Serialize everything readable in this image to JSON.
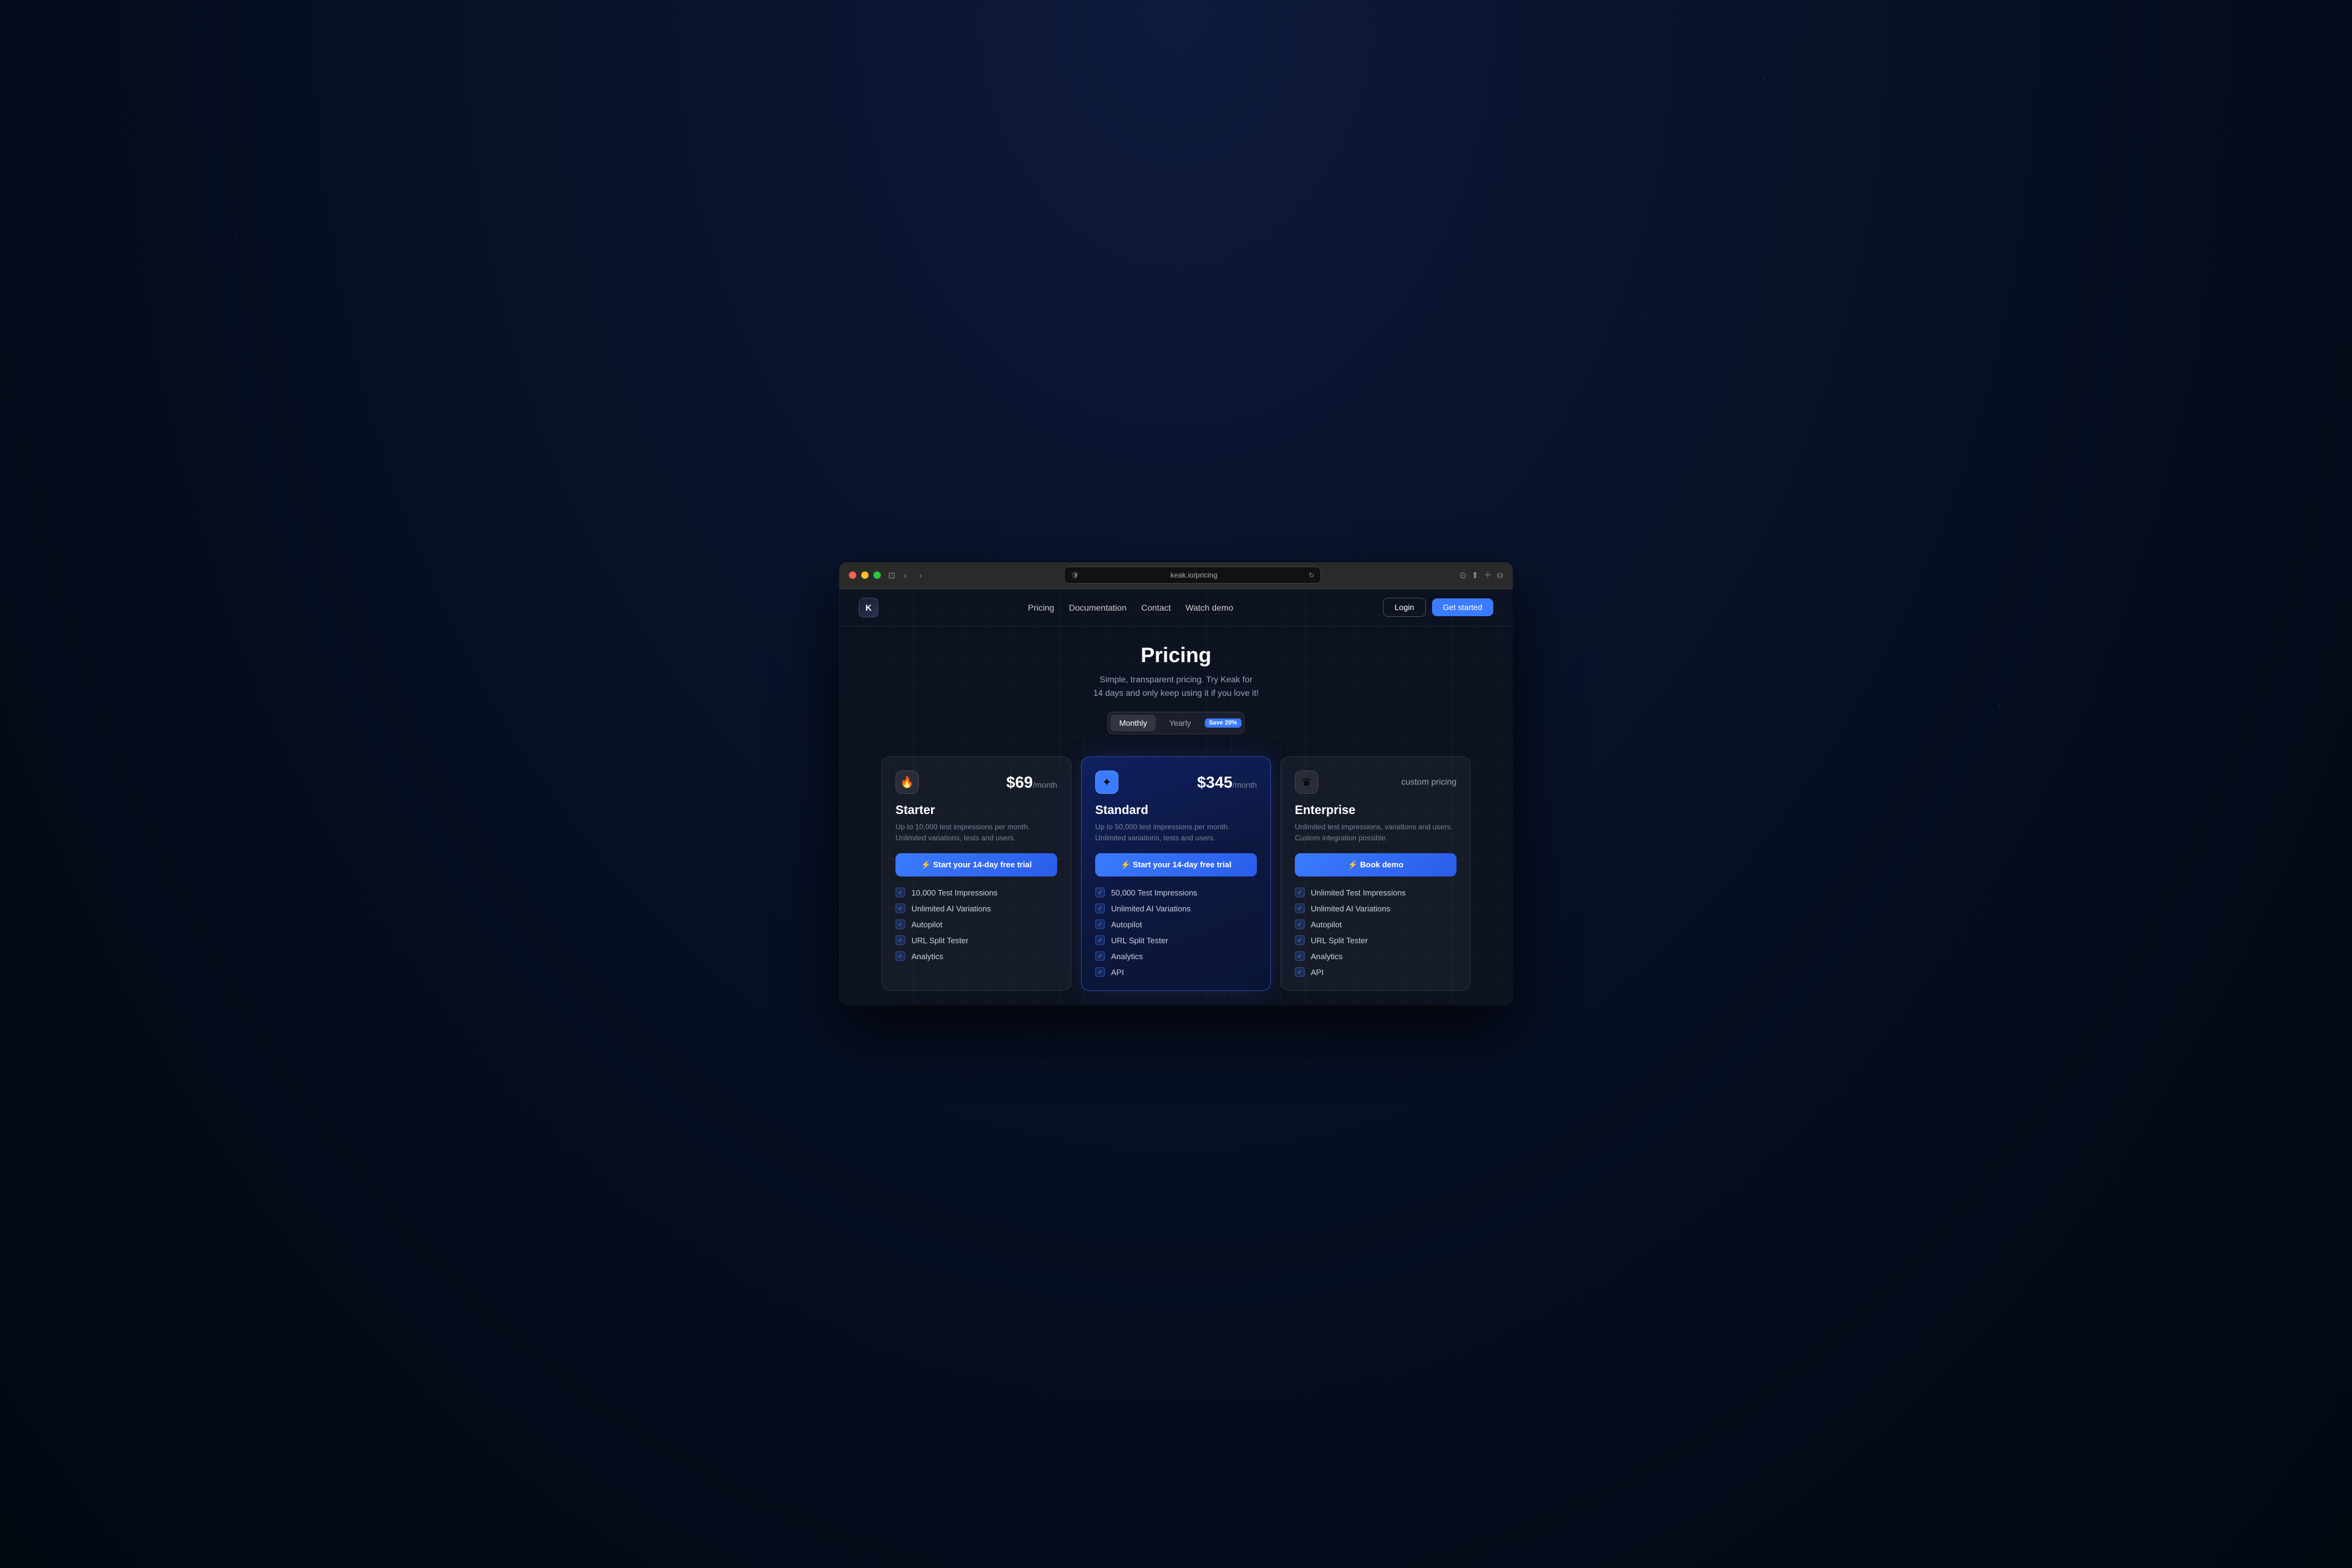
{
  "browser": {
    "address": "keak.io/pricing",
    "back_label": "‹",
    "forward_label": "›"
  },
  "nav": {
    "logo": "K",
    "links": [
      "Pricing",
      "Documentation",
      "Contact",
      "Watch demo"
    ],
    "login_label": "Login",
    "get_started_label": "Get started"
  },
  "hero": {
    "title": "Pricing",
    "subtitle_line1": "Simple, transparent pricing. Try Keak for",
    "subtitle_line2": "14 days and only keep using it if you love it!"
  },
  "billing_toggle": {
    "monthly_label": "Monthly",
    "yearly_label": "Yearly",
    "save_badge": "Save 20%",
    "active": "monthly"
  },
  "plans": [
    {
      "id": "starter",
      "icon": "🔥",
      "price": "$69",
      "period": "/month",
      "name": "Starter",
      "description": "Up to 10,000 test impressions per month. Unlimited variations, tests and users.",
      "cta_label": "⚡ Start your 14-day free trial",
      "featured": false,
      "features": [
        "10,000 Test Impressions",
        "Unlimited AI Variations",
        "Autopilot",
        "URL Split Tester",
        "Analytics"
      ]
    },
    {
      "id": "standard",
      "icon": "✦",
      "price": "$345",
      "period": "/month",
      "name": "Standard",
      "description": "Up to 50,000 test impressions per month. Unlimited variations, tests and users.",
      "cta_label": "⚡ Start your 14-day free trial",
      "featured": true,
      "features": [
        "50,000 Test Impressions",
        "Unlimited AI Variations",
        "Autopilot",
        "URL Split Tester",
        "Analytics",
        "API"
      ]
    },
    {
      "id": "enterprise",
      "icon": "♛",
      "price": "",
      "period": "",
      "custom_pricing": "custom pricing",
      "name": "Enterprise",
      "description": "Unlimited test impressions, variations and users. Custom integration possible.",
      "cta_label": "⚡ Book demo",
      "featured": false,
      "features": [
        "Unlimited Test Impressions",
        "Unlimited AI Variations",
        "Autopilot",
        "URL Split Tester",
        "Analytics",
        "API"
      ]
    }
  ]
}
